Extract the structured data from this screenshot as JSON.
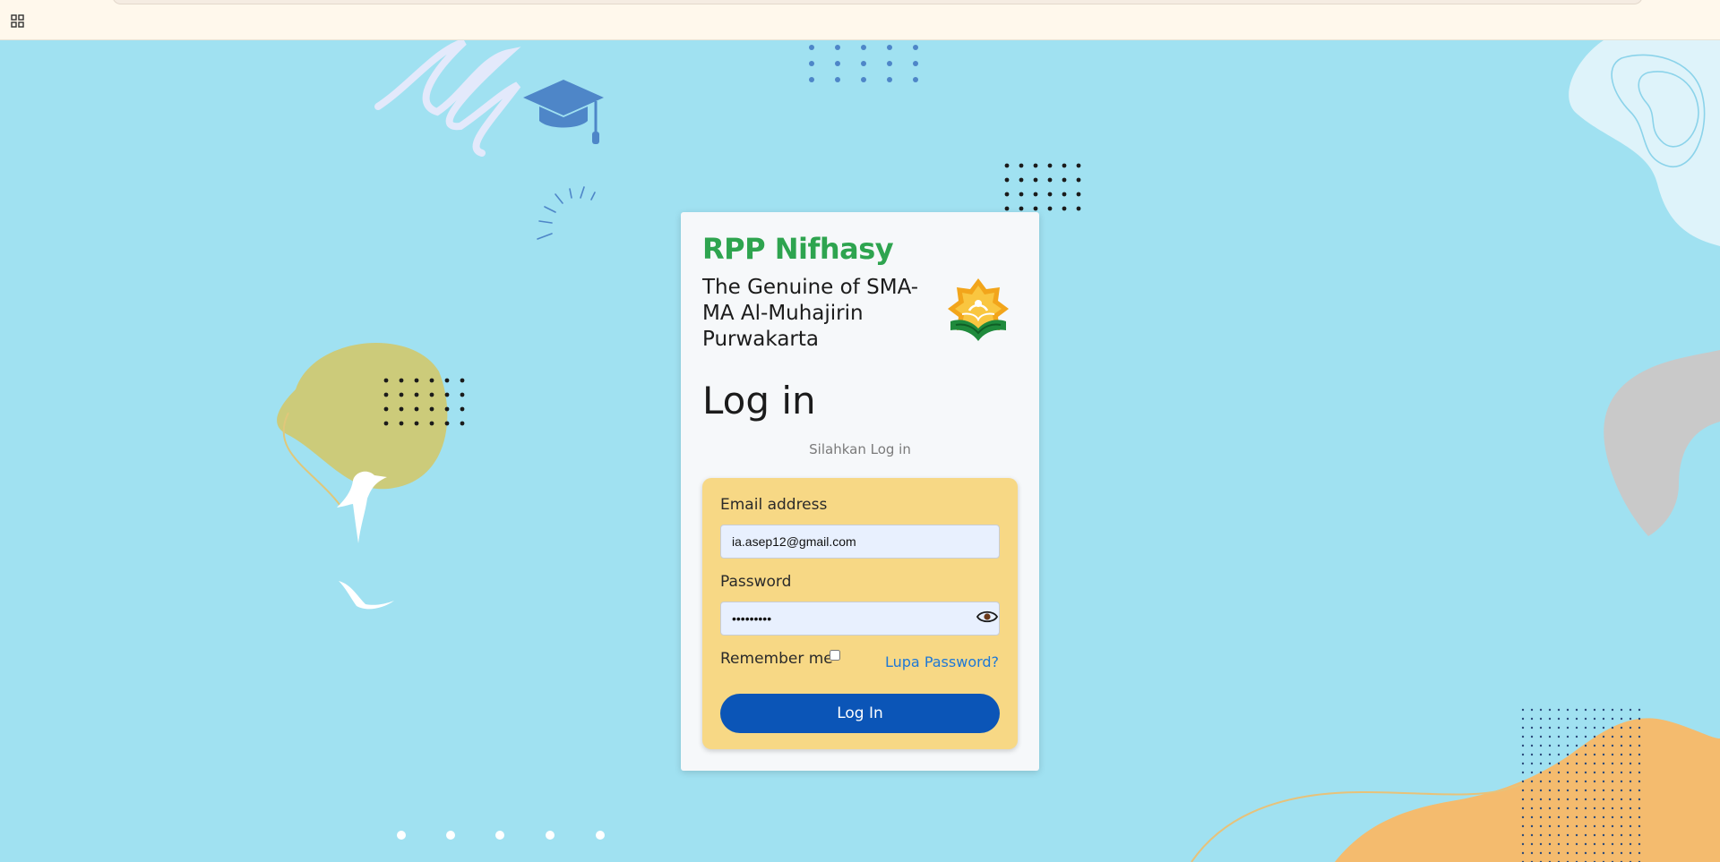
{
  "site": {
    "brand": "RPP Nifhasy",
    "tagline": "The Genuine of SMA-MA Al-Muhajirin Purwakarta",
    "logo_icon": "school-star-book-logo"
  },
  "login": {
    "title": "Log in",
    "subtitle": "Silahkan Log in",
    "email_label": "Email address",
    "email_value": "ia.asep12@gmail.com",
    "password_label": "Password",
    "password_value": "asep12345",
    "remember_label": "Remember me",
    "remember_checked": false,
    "forgot_label": "Lupa Password?",
    "submit_label": "Log In"
  },
  "colors": {
    "background": "#a0e1f1",
    "brand": "#2ea44f",
    "form_box": "#f7d885",
    "button": "#0b55b7",
    "link": "#1e78d6"
  }
}
